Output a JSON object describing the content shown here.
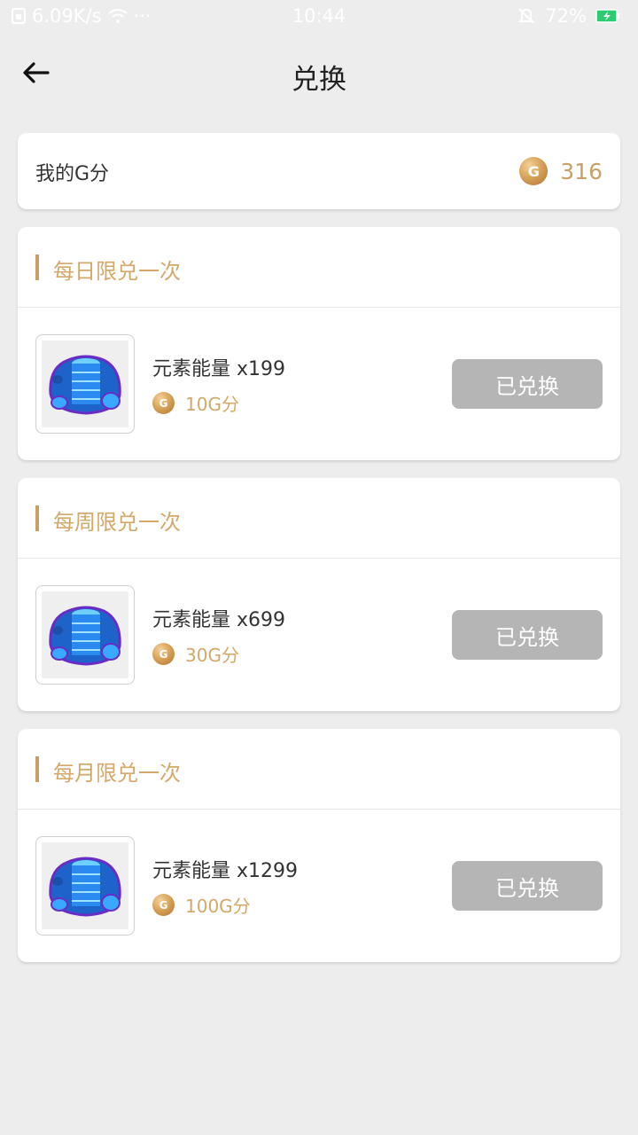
{
  "status_bar": {
    "net_speed": "6.09K/s",
    "more": "···",
    "time": "10:44",
    "battery": "72%"
  },
  "header": {
    "title": "兑换",
    "back_icon": "arrow-left-icon"
  },
  "points": {
    "label": "我的G分",
    "value": "316",
    "coin_glyph": "G"
  },
  "sections": [
    {
      "title": "每日限兑一次",
      "item_name": "元素能量 x199",
      "price": "10G分",
      "button": "已兑换"
    },
    {
      "title": "每周限兑一次",
      "item_name": "元素能量 x699",
      "price": "30G分",
      "button": "已兑换"
    },
    {
      "title": "每月限兑一次",
      "item_name": "元素能量 x1299",
      "price": "100G分",
      "button": "已兑换"
    }
  ],
  "colors": {
    "accent": "#c9a063",
    "button_disabled": "#b5b5b5",
    "background": "#ededed"
  }
}
